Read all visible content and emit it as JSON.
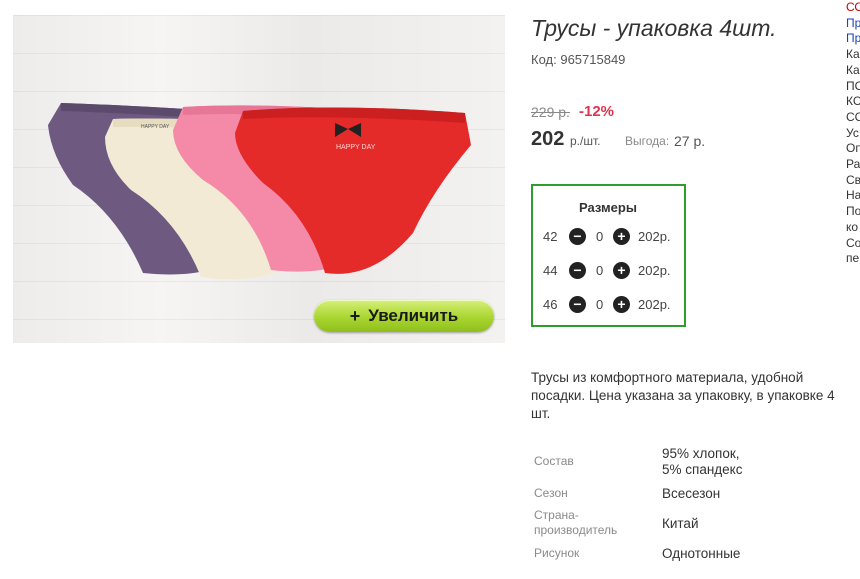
{
  "product": {
    "title": "Трусы - упаковка 4шт.",
    "code_label": "Код:",
    "code": "965715849",
    "old_price": "229 р.",
    "discount": "-12%",
    "price": "202",
    "price_unit": "р./шт.",
    "benefit_label": "Выгода:",
    "benefit_value": "27 р.",
    "zoom_button_label": "Увеличить",
    "image_print_text": "HAPPY DAY"
  },
  "sizes": {
    "title": "Размеры",
    "rows": [
      {
        "size": "42",
        "qty": "0",
        "price": "202р."
      },
      {
        "size": "44",
        "qty": "0",
        "price": "202р."
      },
      {
        "size": "46",
        "qty": "0",
        "price": "202р."
      }
    ]
  },
  "description": "Трусы из комфортного материала, удобной посадки. Цена указана за упаковку, в упаковке 4 шт.",
  "specs": [
    {
      "label": "Состав",
      "value_line1": "95% хлопок,",
      "value_line2": "5% спандекс"
    },
    {
      "label": "Сезон",
      "value": "Всесезон"
    },
    {
      "label_line1": "Страна-",
      "label_line2": "производитель",
      "value": "Китай"
    },
    {
      "label": "Рисунок",
      "value": "Однотонные"
    }
  ],
  "sidebar_fragments": [
    "СО",
    "Пр",
    "Пр",
    "Ка",
    "Ка",
    "ПО",
    "КС",
    "СС",
    "Ус",
    "Оп",
    "Ра",
    "Св",
    "На",
    "По",
    "ко",
    "Со",
    "пе"
  ],
  "colors": {
    "discount": "#e2334f",
    "sizes_border": "#2e9d2e",
    "zoom_button": "#a9d530",
    "sidebar_red": "#cc0000",
    "sidebar_link": "#1a3fc4"
  }
}
